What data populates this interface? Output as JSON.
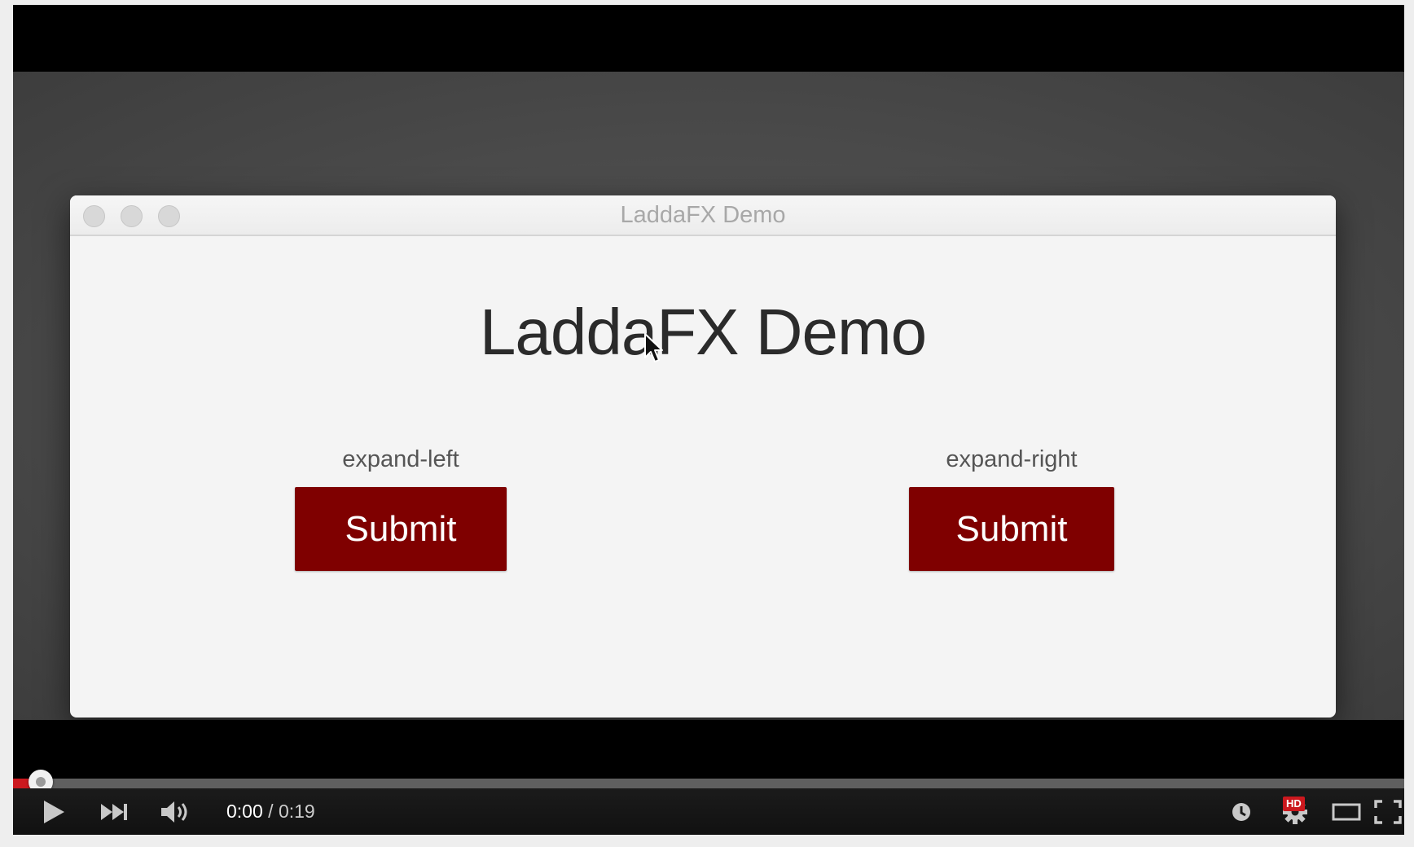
{
  "app_window": {
    "title": "LaddaFX Demo",
    "heading": "LaddaFX Demo",
    "demos": [
      {
        "label": "expand-left",
        "button_label": "Submit"
      },
      {
        "label": "expand-right",
        "button_label": "Submit"
      }
    ],
    "button_color": "#7f0000"
  },
  "player": {
    "current_time": "0:00",
    "separator": " / ",
    "duration": "0:19",
    "progress_fraction": 0.02,
    "hd_badge": "HD",
    "accent_color": "#cc181e",
    "icons": [
      "play-icon",
      "next-icon",
      "volume-icon",
      "watch-later-icon",
      "settings-icon",
      "theater-mode-icon",
      "fullscreen-icon"
    ]
  }
}
